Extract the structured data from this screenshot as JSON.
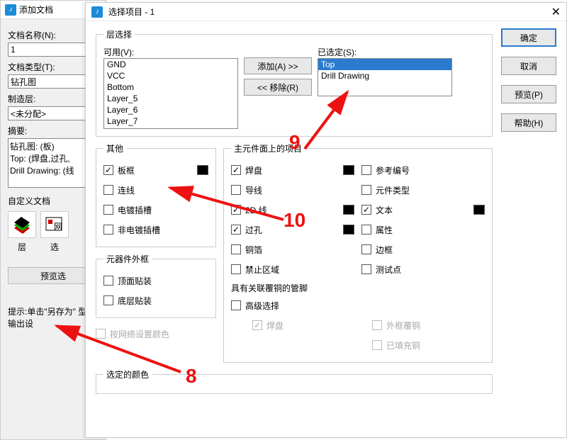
{
  "back": {
    "title": "添加文档",
    "doc_name_label": "文档名称(N):",
    "doc_name_value": "1",
    "doc_type_label": "文档类型(T):",
    "doc_type_value": "钻孔图",
    "mfg_layer_label": "制造层:",
    "mfg_layer_value": "<未分配>",
    "summary_label": "摘要:",
    "summary_lines": [
      "钻孔图: (板)",
      "Top: (焊盘,过孔,",
      "Drill Drawing: (线"
    ],
    "custom_label": "自定义文档",
    "col_layer": "层",
    "col_sel": "选",
    "preview_btn": "预览选",
    "hint": "提示:单击\"另存为\" 型和输出设"
  },
  "front": {
    "title": "选择项目 - 1",
    "layer_select": "层选择",
    "available_label": "可用(V):",
    "available_items": [
      "GND",
      "VCC",
      "Bottom",
      "Layer_5",
      "Layer_6",
      "Layer_7"
    ],
    "add_btn": "添加(A) >>",
    "remove_btn": "<< 移除(R)",
    "selected_label": "已选定(S):",
    "selected_items": [
      "Top",
      "Drill Drawing"
    ],
    "other": {
      "legend": "其他",
      "items": [
        {
          "label": "板框",
          "checked": true,
          "swatch": true
        },
        {
          "label": "连线",
          "checked": false
        },
        {
          "label": "电镀插槽",
          "checked": false
        },
        {
          "label": "非电镀插槽",
          "checked": false
        }
      ],
      "outline_legend": "元器件外框",
      "outline_items": [
        {
          "label": "顶面贴装",
          "checked": false
        },
        {
          "label": "底层贴装",
          "checked": false
        }
      ]
    },
    "main_items": {
      "legend": "主元件面上的项目",
      "left": [
        {
          "label": "焊盘",
          "checked": true,
          "swatch": true
        },
        {
          "label": "导线",
          "checked": false,
          "swatch": false
        },
        {
          "label": "2D 线",
          "checked": true,
          "swatch": true
        },
        {
          "label": "过孔",
          "checked": true,
          "swatch": true
        },
        {
          "label": "铜箔",
          "checked": false
        },
        {
          "label": "禁止区域",
          "checked": false
        }
      ],
      "right": [
        {
          "label": "参考编号",
          "checked": false
        },
        {
          "label": "元件类型",
          "checked": false
        },
        {
          "label": "文本",
          "checked": true,
          "swatch": true
        },
        {
          "label": "属性",
          "checked": false
        },
        {
          "label": "边框",
          "checked": false
        },
        {
          "label": "测试点",
          "checked": false
        }
      ],
      "assoc_label": "具有关联覆铜的管脚",
      "adv_label": "高级选择",
      "adv_items": [
        {
          "label": "焊盘",
          "checked": true,
          "disabled": true
        },
        {
          "label": "外框覆铜",
          "checked": false,
          "disabled": true
        },
        {
          "label": "已填充铜",
          "checked": false,
          "disabled": true
        }
      ]
    },
    "net_color": "按网络设置颜色",
    "selected_color_legend": "选定的颜色",
    "buttons": {
      "ok": "确定",
      "cancel": "取消",
      "preview": "预览(P)",
      "help": "帮助(H)"
    }
  },
  "annotations": {
    "n8": "8",
    "n9": "9",
    "n10": "10"
  }
}
